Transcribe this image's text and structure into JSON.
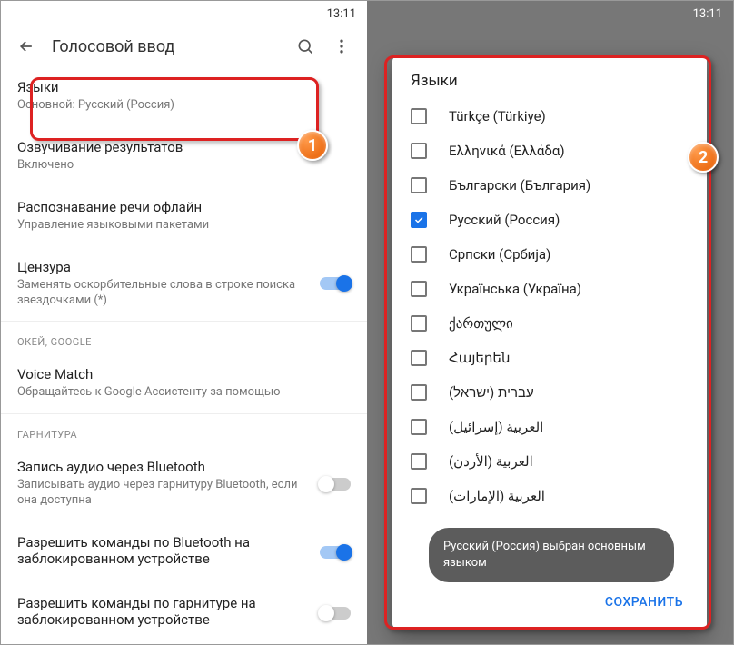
{
  "status": {
    "time": "13:11"
  },
  "left": {
    "title": "Голосовой ввод",
    "items": {
      "languages": {
        "title": "Языки",
        "sub": "Основной: Русский (Россия)"
      },
      "speak": {
        "title": "Озвучивание результатов",
        "sub": "Включено"
      },
      "offline": {
        "title": "Распознавание речи офлайн",
        "sub": "Управление языковыми пакетами"
      },
      "censor": {
        "title": "Цензура",
        "sub": "Заменять оскорбительные слова в строке поиска звездочками (*)"
      },
      "voicematch": {
        "title": "Voice Match",
        "sub": "Обращайтесь к Google Ассистенту за помощью"
      },
      "btaudio": {
        "title": "Запись аудио через Bluetooth",
        "sub": "Записывать аудио через гарнитуру Bluetooth, если она доступнa"
      },
      "btlock": {
        "title": "Разрешить команды по Bluetooth на заблокированном устройстве"
      },
      "headsetlock": {
        "title": "Разрешить команды по гарнитуре на заблокированном устройстве"
      }
    },
    "sections": {
      "okgoogle": "Окей, Google",
      "headset": "Гарнитура"
    }
  },
  "dialog": {
    "title": "Языки",
    "languages": [
      {
        "label": "Türkçe (Türkiye)",
        "checked": false
      },
      {
        "label": "Ελληνικά (Ελλάδα)",
        "checked": false
      },
      {
        "label": "Български (България)",
        "checked": false
      },
      {
        "label": "Русский (Россия)",
        "checked": true
      },
      {
        "label": "Српски (Србија)",
        "checked": false
      },
      {
        "label": "Українська (Україна)",
        "checked": false
      },
      {
        "label": "ქართული",
        "checked": false
      },
      {
        "label": "Հայերեն",
        "checked": false
      },
      {
        "label": "עברית (ישראל)",
        "checked": false,
        "rtl": true
      },
      {
        "label": "العربية (إسرائيل)",
        "checked": false,
        "rtl": true
      },
      {
        "label": "العربية (الأردن)",
        "checked": false,
        "rtl": true
      },
      {
        "label": "العربية (الإمارات)",
        "checked": false,
        "rtl": true
      }
    ],
    "toast": "Русский (Россия) выбран основным языком",
    "save": "СОХРАНИТЬ"
  },
  "badges": {
    "b1": "1",
    "b2": "2"
  }
}
